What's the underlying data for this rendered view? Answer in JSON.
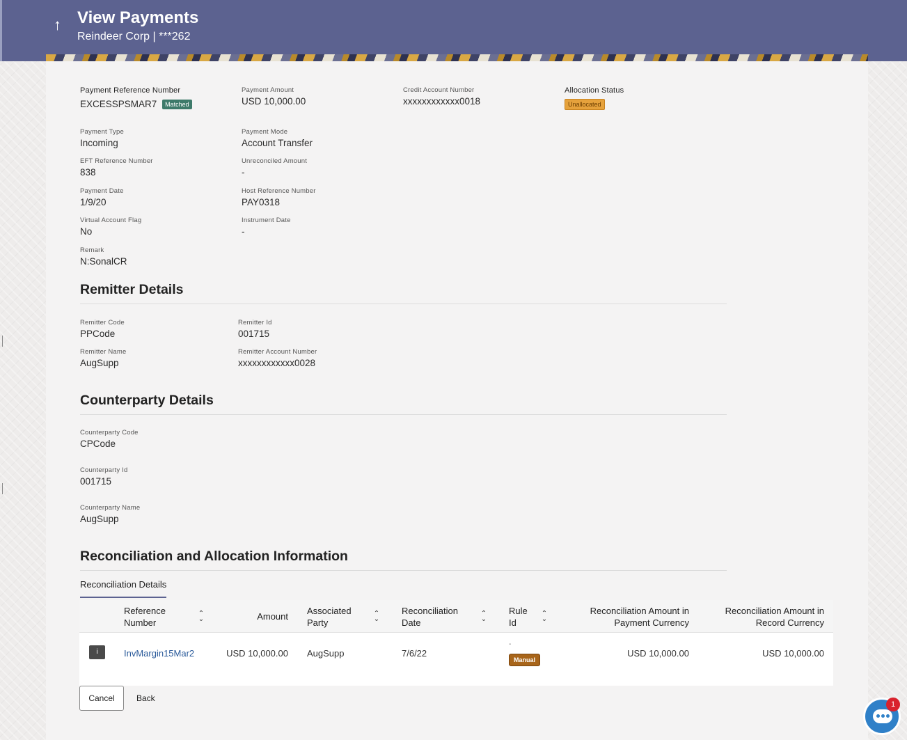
{
  "header": {
    "title": "View Payments",
    "subtitle": "Reindeer Corp | ***262",
    "back_icon": "up-arrow-icon"
  },
  "payment": {
    "ref_label": "Payment Reference Number",
    "ref_value": "EXCESSPSMAR7",
    "ref_status": "Matched",
    "amount_label": "Payment Amount",
    "amount_value": "USD 10,000.00",
    "credit_label": "Credit Account Number",
    "credit_value": "xxxxxxxxxxxx0018",
    "alloc_label": "Allocation Status",
    "alloc_value": "Unallocated",
    "type_label": "Payment Type",
    "type_value": "Incoming",
    "mode_label": "Payment Mode",
    "mode_value": "Account Transfer",
    "eft_label": "EFT Reference Number",
    "eft_value": "838",
    "unrec_label": "Unreconciled Amount",
    "unrec_value": "-",
    "date_label": "Payment Date",
    "date_value": "1/9/20",
    "host_label": "Host Reference Number",
    "host_value": "PAY0318",
    "vaf_label": "Virtual Account Flag",
    "vaf_value": "No",
    "instr_label": "Instrument Date",
    "instr_value": "-",
    "remark_label": "Remark",
    "remark_value": "N:SonalCR"
  },
  "remitter": {
    "title": "Remitter Details",
    "code_label": "Remitter Code",
    "code_value": "PPCode",
    "id_label": "Remitter Id",
    "id_value": "001715",
    "name_label": "Remitter Name",
    "name_value": "AugSupp",
    "acct_label": "Remitter Account Number",
    "acct_value": "xxxxxxxxxxxx0028"
  },
  "counterparty": {
    "title": "Counterparty Details",
    "code_label": "Counterparty Code",
    "code_value": "CPCode",
    "id_label": "Counterparty Id",
    "id_value": "001715",
    "name_label": "Counterparty Name",
    "name_value": "AugSupp"
  },
  "reconciliation": {
    "title": "Reconciliation and Allocation Information",
    "tab_label": "Reconciliation Details",
    "columns": {
      "ref": "Reference Number",
      "amount": "Amount",
      "party": "Associated Party",
      "date": "Reconciliation Date",
      "rule": "Rule Id",
      "pay_amt": "Reconciliation Amount in Payment Currency",
      "rec_amt": "Reconciliation Amount in Record Currency"
    },
    "rows": [
      {
        "ref": "InvMargin15Mar2",
        "amount": "USD 10,000.00",
        "party": "AugSupp",
        "date": "7/6/22",
        "rule": "-",
        "rule_badge": "Manual",
        "pay_amt": "USD 10,000.00",
        "rec_amt": "USD 10,000.00"
      }
    ]
  },
  "actions": {
    "cancel": "Cancel",
    "back": "Back"
  },
  "chat": {
    "badge_count": "1"
  },
  "colors": {
    "header_bg": "#5c6290",
    "matched": "#3e7a6a",
    "unallocated": "#e6a23c",
    "manual": "#a8651a",
    "link": "#2a5a9a",
    "chat": "#2f80c8"
  }
}
